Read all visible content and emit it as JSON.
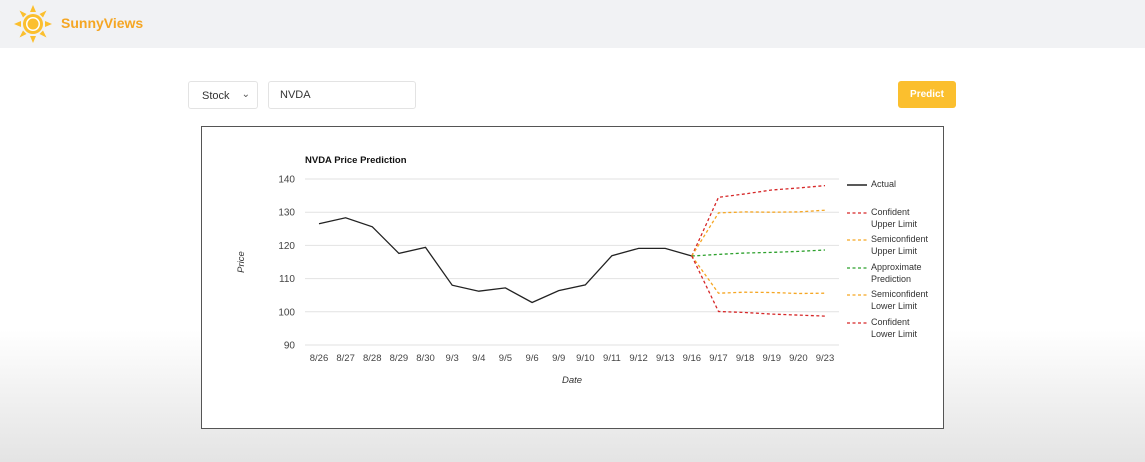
{
  "header": {
    "brand": "SunnyViews"
  },
  "controls": {
    "type_select": "Stock",
    "ticker_value": "NVDA",
    "predict_label": "Predict"
  },
  "colors": {
    "brand": "#f5a623",
    "actual": "#222222",
    "confident": "#d62728",
    "semiconfident": "#f5a623",
    "approximate": "#2ca02c"
  },
  "chart_data": {
    "type": "line",
    "title": "NVDA Price Prediction",
    "xlabel": "Date",
    "ylabel": "Price",
    "categories": [
      "8/26",
      "8/27",
      "8/28",
      "8/29",
      "8/30",
      "9/3",
      "9/4",
      "9/5",
      "9/6",
      "9/9",
      "9/10",
      "9/11",
      "9/12",
      "9/13",
      "9/16",
      "9/17",
      "9/18",
      "9/19",
      "9/20",
      "9/23"
    ],
    "ylim": [
      90,
      140
    ],
    "yticks": [
      90,
      100,
      110,
      120,
      130,
      140
    ],
    "grid": true,
    "legend_position": "right",
    "series": [
      {
        "name": "Actual",
        "color": "#222222",
        "dashed": false,
        "values": [
          126.5,
          128.3,
          125.6,
          117.6,
          119.4,
          108.0,
          106.2,
          107.2,
          102.8,
          106.4,
          108.1,
          116.9,
          119.1,
          119.1,
          116.8,
          null,
          null,
          null,
          null,
          null
        ]
      },
      {
        "name": "Confident Upper Limit",
        "color": "#d62728",
        "dashed": true,
        "values": [
          null,
          null,
          null,
          null,
          null,
          null,
          null,
          null,
          null,
          null,
          null,
          null,
          null,
          null,
          116.8,
          134.5,
          135.5,
          136.7,
          137.3,
          138.0
        ]
      },
      {
        "name": "Semiconfident Upper Limit",
        "color": "#f5a623",
        "dashed": true,
        "values": [
          null,
          null,
          null,
          null,
          null,
          null,
          null,
          null,
          null,
          null,
          null,
          null,
          null,
          null,
          116.8,
          129.8,
          130.1,
          130.0,
          130.1,
          130.6
        ]
      },
      {
        "name": "Approximate Prediction",
        "color": "#2ca02c",
        "dashed": true,
        "values": [
          null,
          null,
          null,
          null,
          null,
          null,
          null,
          null,
          null,
          null,
          null,
          null,
          null,
          null,
          116.8,
          117.3,
          117.7,
          117.9,
          118.2,
          118.6
        ]
      },
      {
        "name": "Semiconfident Lower Limit",
        "color": "#f5a623",
        "dashed": true,
        "values": [
          null,
          null,
          null,
          null,
          null,
          null,
          null,
          null,
          null,
          null,
          null,
          null,
          null,
          null,
          116.8,
          105.6,
          105.9,
          105.8,
          105.5,
          105.6
        ]
      },
      {
        "name": "Confident Lower Limit",
        "color": "#d62728",
        "dashed": true,
        "values": [
          null,
          null,
          null,
          null,
          null,
          null,
          null,
          null,
          null,
          null,
          null,
          null,
          null,
          null,
          116.8,
          100.1,
          99.8,
          99.3,
          99.0,
          98.7
        ]
      }
    ],
    "legend": [
      {
        "lines": [
          "Actual"
        ]
      },
      {
        "lines": [
          "Confident",
          "Upper Limit"
        ]
      },
      {
        "lines": [
          "Semiconfident",
          "Upper Limit"
        ]
      },
      {
        "lines": [
          "Approximate",
          "Prediction"
        ]
      },
      {
        "lines": [
          "Semiconfident",
          "Lower Limit"
        ]
      },
      {
        "lines": [
          "Confident",
          "Lower Limit"
        ]
      }
    ]
  }
}
